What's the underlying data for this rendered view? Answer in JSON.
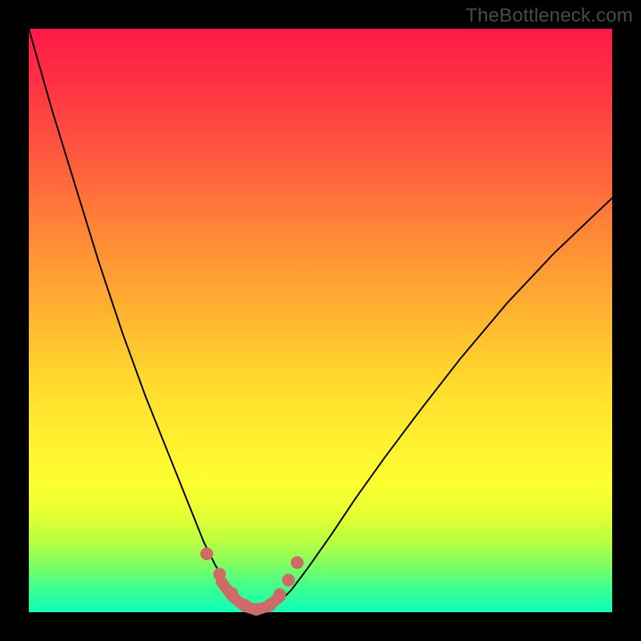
{
  "watermark": "TheBottleneck.com",
  "chart_data": {
    "type": "line",
    "title": "",
    "xlabel": "",
    "ylabel": "",
    "xlim": [
      0,
      100
    ],
    "ylim": [
      0,
      100
    ],
    "grid": false,
    "series": [
      {
        "name": "bottleneck-curve",
        "color": "#000000",
        "stroke_width": 2,
        "x": [
          0,
          4,
          8,
          12,
          16,
          20,
          24,
          28,
          30,
          32,
          33.5,
          35,
          36.5,
          38,
          39.5,
          41,
          43,
          45,
          48,
          52,
          56,
          61,
          67,
          74,
          82,
          90,
          100
        ],
        "y": [
          100,
          86,
          73,
          60,
          48,
          37,
          27,
          17,
          12,
          8,
          5.5,
          3.2,
          1.6,
          0.6,
          0.2,
          0.6,
          1.8,
          3.8,
          7.8,
          13.5,
          19.5,
          26.5,
          34.5,
          43.5,
          53,
          61.5,
          71
        ]
      },
      {
        "name": "highlight-markers",
        "color": "#cf6b66",
        "marker_radius": 8,
        "x": [
          30.5,
          32.7,
          34.8,
          37.0,
          39.0,
          41.3,
          43.0,
          44.5,
          46.0
        ],
        "y": [
          10.0,
          6.5,
          3.2,
          1.2,
          0.5,
          1.2,
          3.0,
          5.5,
          8.5
        ]
      },
      {
        "name": "highlight-segment",
        "color": "#cf6b66",
        "stroke_width": 14,
        "x": [
          33.0,
          35.0,
          37.0,
          39.0,
          41.0,
          43.0
        ],
        "y": [
          5.2,
          2.6,
          1.0,
          0.4,
          1.0,
          2.6
        ]
      }
    ],
    "gradient": {
      "direction": "vertical",
      "stops": [
        {
          "offset": 0,
          "color": "#ff1a47"
        },
        {
          "offset": 22,
          "color": "#ff5a3f"
        },
        {
          "offset": 48,
          "color": "#ffb030"
        },
        {
          "offset": 70,
          "color": "#ffef2e"
        },
        {
          "offset": 88,
          "color": "#b8ff40"
        },
        {
          "offset": 100,
          "color": "#10ffbc"
        }
      ]
    }
  }
}
